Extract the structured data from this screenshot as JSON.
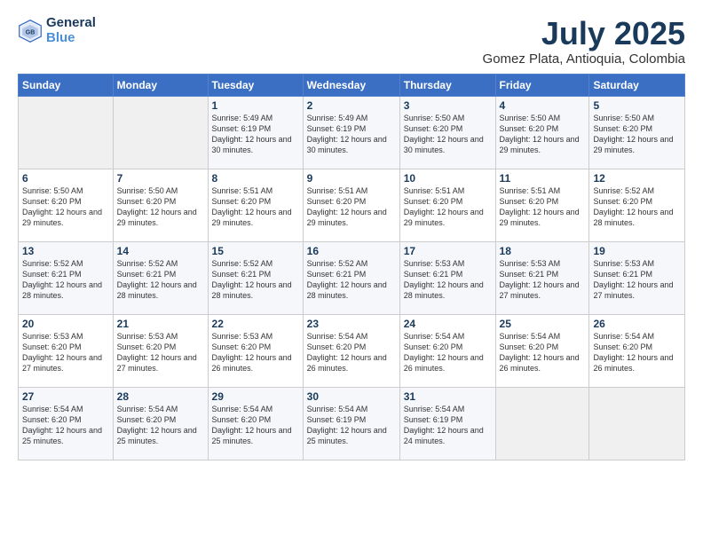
{
  "header": {
    "logo_line1": "General",
    "logo_line2": "Blue",
    "month": "July 2025",
    "location": "Gomez Plata, Antioquia, Colombia"
  },
  "days_of_week": [
    "Sunday",
    "Monday",
    "Tuesday",
    "Wednesday",
    "Thursday",
    "Friday",
    "Saturday"
  ],
  "weeks": [
    [
      {
        "num": "",
        "info": ""
      },
      {
        "num": "",
        "info": ""
      },
      {
        "num": "1",
        "info": "Sunrise: 5:49 AM\nSunset: 6:19 PM\nDaylight: 12 hours\nand 30 minutes."
      },
      {
        "num": "2",
        "info": "Sunrise: 5:49 AM\nSunset: 6:19 PM\nDaylight: 12 hours\nand 30 minutes."
      },
      {
        "num": "3",
        "info": "Sunrise: 5:50 AM\nSunset: 6:20 PM\nDaylight: 12 hours\nand 30 minutes."
      },
      {
        "num": "4",
        "info": "Sunrise: 5:50 AM\nSunset: 6:20 PM\nDaylight: 12 hours\nand 29 minutes."
      },
      {
        "num": "5",
        "info": "Sunrise: 5:50 AM\nSunset: 6:20 PM\nDaylight: 12 hours\nand 29 minutes."
      }
    ],
    [
      {
        "num": "6",
        "info": "Sunrise: 5:50 AM\nSunset: 6:20 PM\nDaylight: 12 hours\nand 29 minutes."
      },
      {
        "num": "7",
        "info": "Sunrise: 5:50 AM\nSunset: 6:20 PM\nDaylight: 12 hours\nand 29 minutes."
      },
      {
        "num": "8",
        "info": "Sunrise: 5:51 AM\nSunset: 6:20 PM\nDaylight: 12 hours\nand 29 minutes."
      },
      {
        "num": "9",
        "info": "Sunrise: 5:51 AM\nSunset: 6:20 PM\nDaylight: 12 hours\nand 29 minutes."
      },
      {
        "num": "10",
        "info": "Sunrise: 5:51 AM\nSunset: 6:20 PM\nDaylight: 12 hours\nand 29 minutes."
      },
      {
        "num": "11",
        "info": "Sunrise: 5:51 AM\nSunset: 6:20 PM\nDaylight: 12 hours\nand 29 minutes."
      },
      {
        "num": "12",
        "info": "Sunrise: 5:52 AM\nSunset: 6:20 PM\nDaylight: 12 hours\nand 28 minutes."
      }
    ],
    [
      {
        "num": "13",
        "info": "Sunrise: 5:52 AM\nSunset: 6:21 PM\nDaylight: 12 hours\nand 28 minutes."
      },
      {
        "num": "14",
        "info": "Sunrise: 5:52 AM\nSunset: 6:21 PM\nDaylight: 12 hours\nand 28 minutes."
      },
      {
        "num": "15",
        "info": "Sunrise: 5:52 AM\nSunset: 6:21 PM\nDaylight: 12 hours\nand 28 minutes."
      },
      {
        "num": "16",
        "info": "Sunrise: 5:52 AM\nSunset: 6:21 PM\nDaylight: 12 hours\nand 28 minutes."
      },
      {
        "num": "17",
        "info": "Sunrise: 5:53 AM\nSunset: 6:21 PM\nDaylight: 12 hours\nand 28 minutes."
      },
      {
        "num": "18",
        "info": "Sunrise: 5:53 AM\nSunset: 6:21 PM\nDaylight: 12 hours\nand 27 minutes."
      },
      {
        "num": "19",
        "info": "Sunrise: 5:53 AM\nSunset: 6:21 PM\nDaylight: 12 hours\nand 27 minutes."
      }
    ],
    [
      {
        "num": "20",
        "info": "Sunrise: 5:53 AM\nSunset: 6:20 PM\nDaylight: 12 hours\nand 27 minutes."
      },
      {
        "num": "21",
        "info": "Sunrise: 5:53 AM\nSunset: 6:20 PM\nDaylight: 12 hours\nand 27 minutes."
      },
      {
        "num": "22",
        "info": "Sunrise: 5:53 AM\nSunset: 6:20 PM\nDaylight: 12 hours\nand 26 minutes."
      },
      {
        "num": "23",
        "info": "Sunrise: 5:54 AM\nSunset: 6:20 PM\nDaylight: 12 hours\nand 26 minutes."
      },
      {
        "num": "24",
        "info": "Sunrise: 5:54 AM\nSunset: 6:20 PM\nDaylight: 12 hours\nand 26 minutes."
      },
      {
        "num": "25",
        "info": "Sunrise: 5:54 AM\nSunset: 6:20 PM\nDaylight: 12 hours\nand 26 minutes."
      },
      {
        "num": "26",
        "info": "Sunrise: 5:54 AM\nSunset: 6:20 PM\nDaylight: 12 hours\nand 26 minutes."
      }
    ],
    [
      {
        "num": "27",
        "info": "Sunrise: 5:54 AM\nSunset: 6:20 PM\nDaylight: 12 hours\nand 25 minutes."
      },
      {
        "num": "28",
        "info": "Sunrise: 5:54 AM\nSunset: 6:20 PM\nDaylight: 12 hours\nand 25 minutes."
      },
      {
        "num": "29",
        "info": "Sunrise: 5:54 AM\nSunset: 6:20 PM\nDaylight: 12 hours\nand 25 minutes."
      },
      {
        "num": "30",
        "info": "Sunrise: 5:54 AM\nSunset: 6:19 PM\nDaylight: 12 hours\nand 25 minutes."
      },
      {
        "num": "31",
        "info": "Sunrise: 5:54 AM\nSunset: 6:19 PM\nDaylight: 12 hours\nand 24 minutes."
      },
      {
        "num": "",
        "info": ""
      },
      {
        "num": "",
        "info": ""
      }
    ]
  ]
}
